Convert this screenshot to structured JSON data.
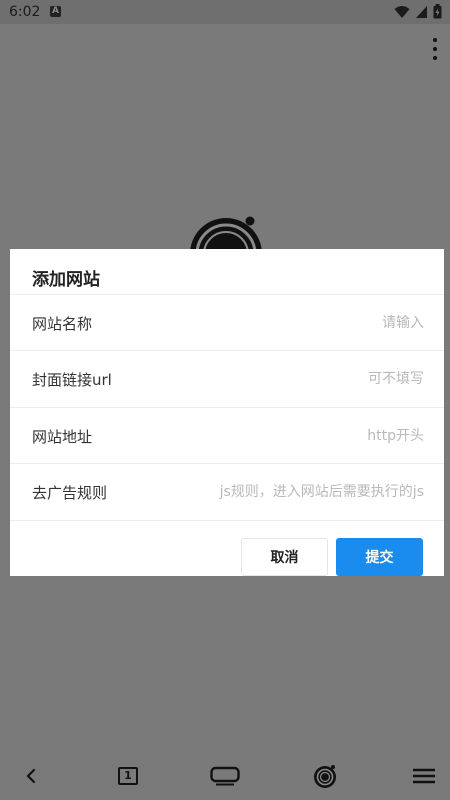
{
  "status_bar": {
    "time": "6:02",
    "notification_letter": "A",
    "icons": [
      "wifi-icon",
      "cell-signal-icon",
      "battery-icon"
    ]
  },
  "dialog": {
    "title": "添加网站",
    "fields": [
      {
        "label": "网站名称",
        "value": "",
        "placeholder": "请输入"
      },
      {
        "label": "封面链接url",
        "value": "",
        "placeholder": "可不填写"
      },
      {
        "label": "网站地址",
        "value": "",
        "placeholder": "http开头"
      },
      {
        "label": "去广告规则",
        "value": "",
        "placeholder": "js规则，进入网站后需要执行的js"
      }
    ],
    "cancel_label": "取消",
    "submit_label": "提交"
  },
  "bottom_nav": {
    "tab_count": "1",
    "items": [
      "back-icon",
      "tabs-icon",
      "window-icon",
      "home-logo-icon",
      "menu-icon"
    ]
  },
  "colors": {
    "accent": "#1a8cf0",
    "overlay": "#7a7a7a",
    "dialog_bg": "#ffffff"
  }
}
